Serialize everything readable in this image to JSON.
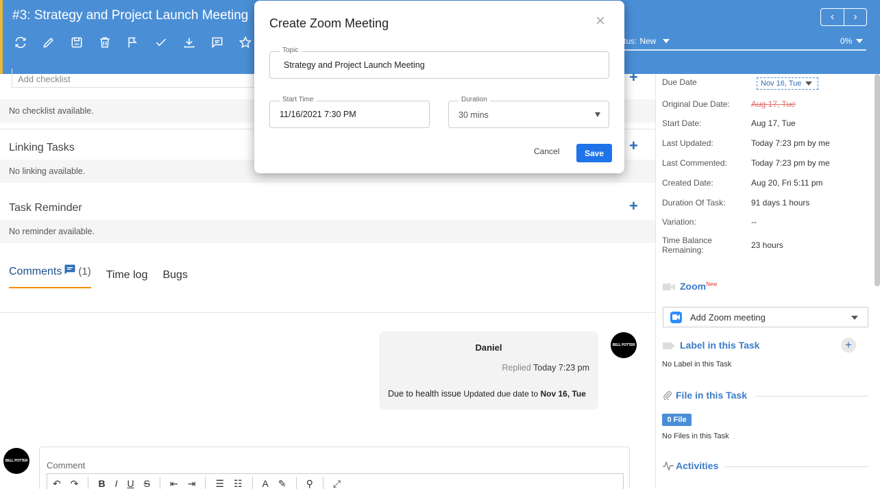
{
  "header": {
    "title": "#3: Strategy and Project Launch Meeting",
    "status_label": "tus:",
    "status_value": "New",
    "progress": "0%",
    "prev": "‹",
    "next": "›",
    "toolbar_icons": [
      "refresh-icon",
      "edit-icon",
      "save-icon",
      "delete-icon",
      "flag-icon",
      "check-icon",
      "download-icon",
      "comment-icon",
      "star-icon"
    ]
  },
  "left": {
    "checklist_placeholder": "Add checklist",
    "no_checklist": "No checklist available.",
    "linking_title": "Linking Tasks",
    "no_linking": "No linking available.",
    "reminder_title": "Task Reminder",
    "no_reminder": "No reminder available.",
    "tabs": {
      "comments": "Comments",
      "comments_count": "(1)",
      "timelog": "Time log",
      "bugs": "Bugs"
    },
    "comment": {
      "author": "Daniel",
      "replied_label": "Replied",
      "replied_time": "Today 7:23 pm",
      "text_main": "Due to health issue",
      "text_update": "Updated due date to",
      "text_date": "Nov 16, Tue"
    },
    "avatar_text": "BELL POTTER",
    "comment_label": "Comment"
  },
  "right": {
    "due_date_label": "Due Date",
    "due_date_value": "Nov 16, Tue",
    "rows": [
      {
        "k": "Original Due Date:",
        "v": "Aug 17, Tue"
      },
      {
        "k": "Start Date:",
        "v": "Aug 17, Tue"
      },
      {
        "k": "Last Updated:",
        "v": "Today 7:23 pm by me"
      },
      {
        "k": "Last Commented:",
        "v": "Today 7:23 pm by me"
      },
      {
        "k": "Created Date:",
        "v": "Aug 20, Fri 5:11 pm"
      },
      {
        "k": "Duration Of Task:",
        "v": "91 days 1 hours"
      },
      {
        "k": "Variation:",
        "v": "--"
      },
      {
        "k": "Time Balance Remaining:",
        "v": "23 hours"
      }
    ],
    "zoom_title": "Zoom",
    "zoom_new": "New",
    "zoom_select": "Add Zoom meeting",
    "label_title": "Label in this Task",
    "no_label": "No Label in this Task",
    "file_title": "File in this Task",
    "file_badge": "0 File",
    "no_files": "No Files in this Task",
    "activities_title": "Activities"
  },
  "modal": {
    "title": "Create Zoom Meeting",
    "close": "×",
    "topic_label": "Topic",
    "topic_value": "Strategy and Project Launch Meeting",
    "start_label": "Start Time",
    "start_value": "11/16/2021 7:30 PM",
    "duration_label": "Duration",
    "duration_value": "30 mins",
    "cancel": "Cancel",
    "save": "Save"
  },
  "colors": {
    "header": "#4a8fd6",
    "accent": "#1f73e8",
    "tab_underline": "#f08c00"
  }
}
